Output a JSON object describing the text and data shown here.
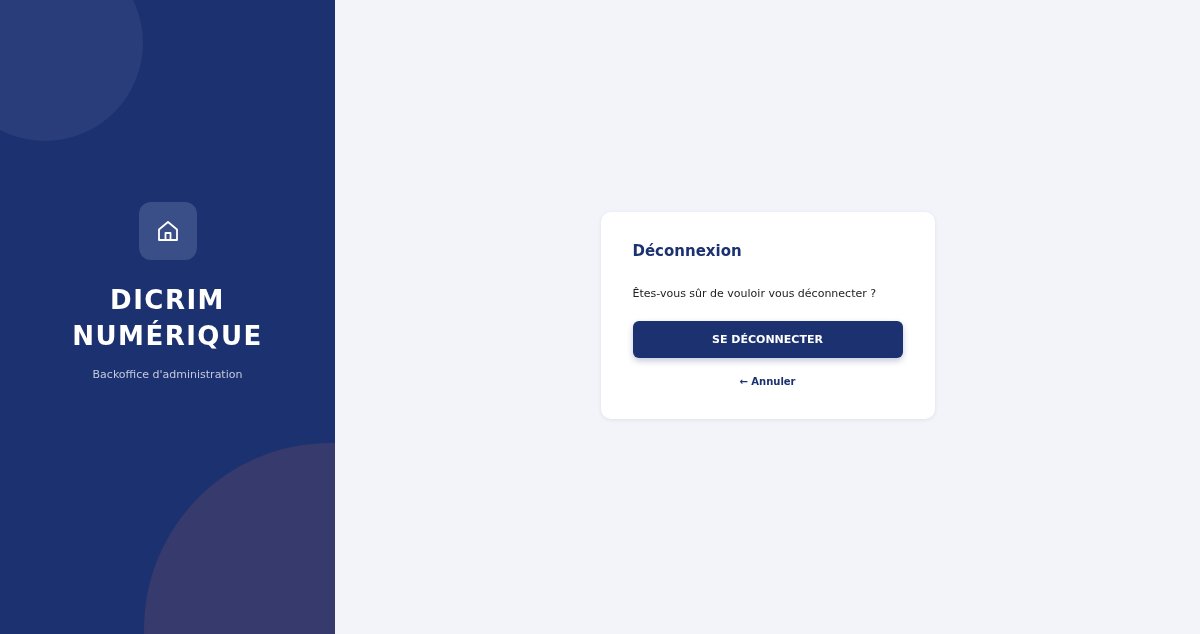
{
  "brand": {
    "title_lines": [
      "DICRIM",
      "NUMÉRIQUE"
    ],
    "subtitle": "Backoffice d'administration"
  },
  "dialog": {
    "title": "Déconnexion",
    "message": "Êtes-vous sûr de vouloir vous déconnecter ?",
    "confirm_button": "SE DÉCONNECTER",
    "cancel_link": "← Annuler"
  }
}
